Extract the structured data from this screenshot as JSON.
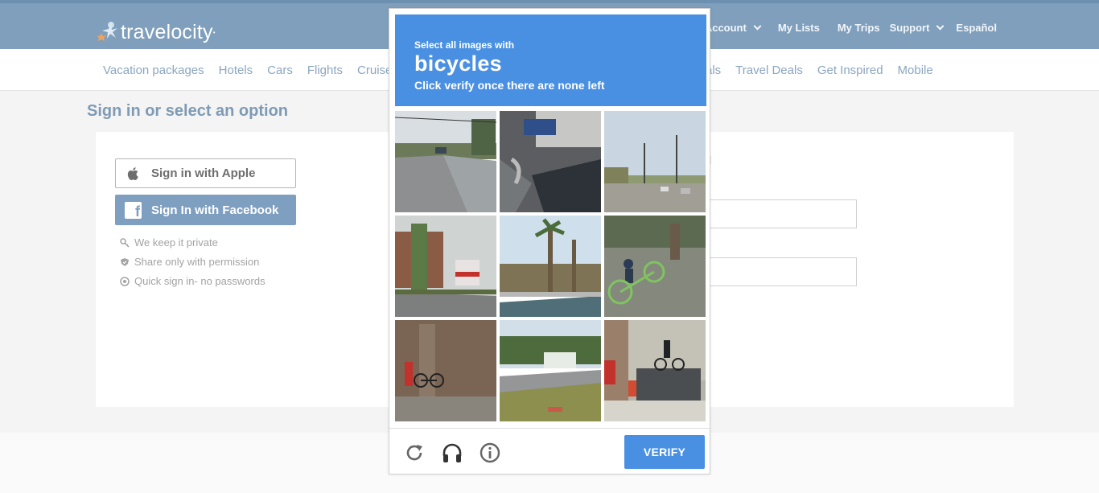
{
  "header": {
    "logo_text": "travelocity",
    "links": [
      {
        "label": "Account",
        "dropdown": true
      },
      {
        "label": "My Lists",
        "dropdown": false
      },
      {
        "label": "My Trips",
        "dropdown": false
      },
      {
        "label": "Support",
        "dropdown": true
      },
      {
        "label": "Español",
        "dropdown": false
      }
    ]
  },
  "subnav": {
    "left_items": [
      "Vacation packages",
      "Hotels",
      "Cars",
      "Flights",
      "Cruise"
    ],
    "partial_item": "als",
    "right_items": [
      "Travel Deals",
      "Get Inspired",
      "Mobile"
    ]
  },
  "page": {
    "title": "Sign in or select an option",
    "apple_button": "Sign in with Apple",
    "facebook_button": "Sign In with Facebook",
    "perks": [
      "We keep it private",
      "Share only with permission",
      "Quick sign in- no passwords"
    ],
    "email_link_partial": "il"
  },
  "captcha": {
    "instruction": "Select all images with",
    "target": "bicycles",
    "subinstruction": "Click verify once there are none left",
    "verify_label": "VERIFY",
    "header_color": "#4a90e2",
    "icons": [
      "reload-icon",
      "audio-headphones-icon",
      "info-icon"
    ],
    "tiles": [
      {
        "scene": "residential street"
      },
      {
        "scene": "car and truck closeup"
      },
      {
        "scene": "highway with traffic lights"
      },
      {
        "scene": "bus at stop"
      },
      {
        "scene": "palm trees road"
      },
      {
        "scene": "bicycle on ground"
      },
      {
        "scene": "bicycle by brick wall"
      },
      {
        "scene": "grassy roadside"
      },
      {
        "scene": "bicycle sculpture by building"
      }
    ]
  },
  "colors": {
    "brand_blue": "#7f9fbc",
    "nav_text": "#8ba6c0"
  }
}
